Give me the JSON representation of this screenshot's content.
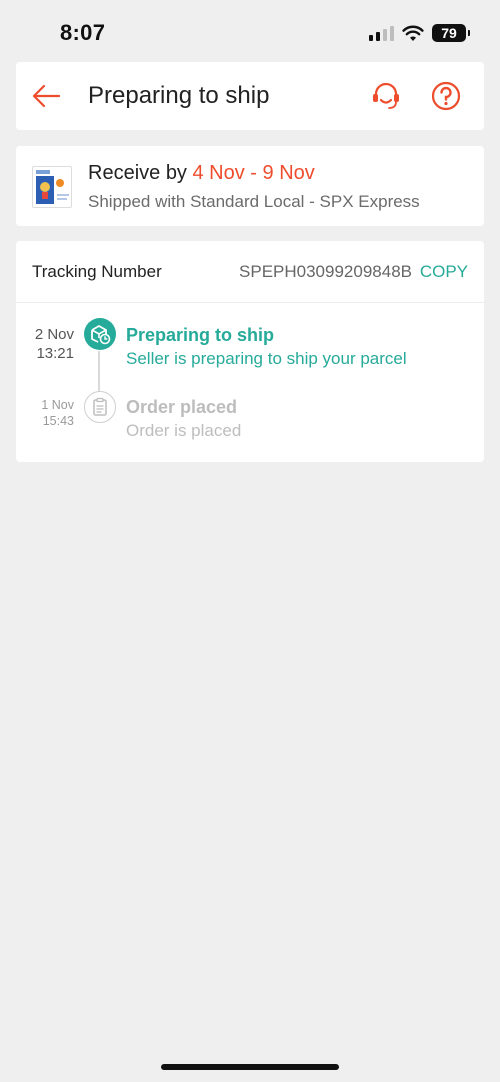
{
  "status_bar": {
    "time": "8:07",
    "battery": "79",
    "icons": [
      "signal-icon",
      "wifi-icon",
      "battery-icon"
    ]
  },
  "header": {
    "title": "Preparing to ship",
    "back_icon": "back-arrow-icon",
    "support_icon": "headset-icon",
    "help_icon": "help-icon"
  },
  "delivery": {
    "receive_prefix": "Receive by",
    "receive_dates": "4 Nov - 9 Nov",
    "shipped_with": "Shipped with Standard Local - SPX Express",
    "thumbnail_icon": "product-thumbnail"
  },
  "tracking": {
    "label": "Tracking Number",
    "number": "SPEPH03099209848B",
    "copy_label": "COPY",
    "events": [
      {
        "date": "2 Nov",
        "time": "13:21",
        "title": "Preparing to ship",
        "description": "Seller is preparing to ship your parcel",
        "icon": "package-clock-icon",
        "active": true
      },
      {
        "date": "1 Nov",
        "time": "15:43",
        "title": "Order placed",
        "description": "Order is placed",
        "icon": "clipboard-icon",
        "active": false
      }
    ]
  },
  "colors": {
    "accent": "#ee4d2d",
    "teal": "#26aa99",
    "background": "#efefef",
    "muted": "#bdbdbd"
  }
}
